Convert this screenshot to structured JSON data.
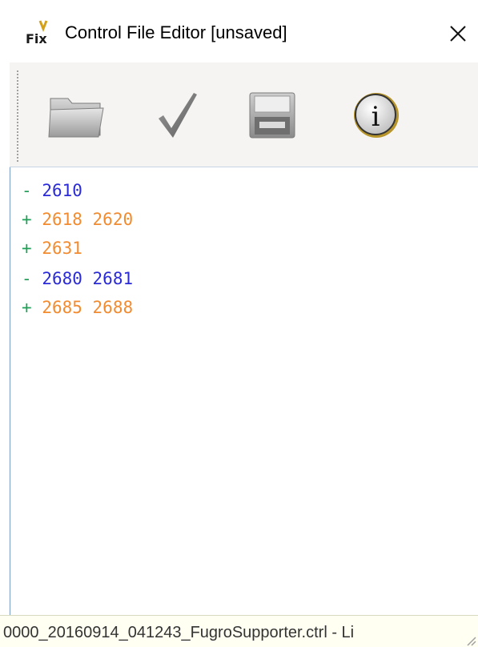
{
  "window": {
    "title": "Control File Editor [unsaved]",
    "app_icon": "fix-app-icon",
    "close_glyph": "✕"
  },
  "toolbar": {
    "buttons": [
      {
        "icon": "open-folder-icon"
      },
      {
        "icon": "checkmark-icon"
      },
      {
        "icon": "save-disk-icon"
      },
      {
        "icon": "info-icon"
      }
    ]
  },
  "editor": {
    "lines": [
      {
        "sign": "-",
        "numbers": "2610",
        "kind": "remove"
      },
      {
        "sign": "+",
        "numbers": "2618 2620",
        "kind": "add"
      },
      {
        "sign": "+",
        "numbers": "2631",
        "kind": "add"
      },
      {
        "sign": "-",
        "numbers": "2680 2681",
        "kind": "remove"
      },
      {
        "sign": "+",
        "numbers": "2685 2688",
        "kind": "add"
      }
    ],
    "colors": {
      "add_sign": "#1fa056",
      "add_numbers": "#f28b2f",
      "remove_numbers": "#2b2bd6"
    }
  },
  "statusbar": {
    "text": "0000_20160914_041243_FugroSupporter.ctrl - Li"
  }
}
